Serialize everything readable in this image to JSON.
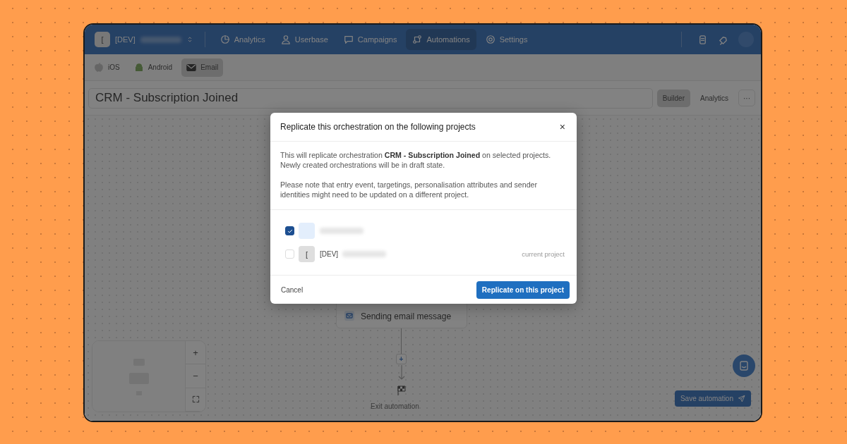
{
  "nav": {
    "project_initial": "[",
    "project_label": "[DEV]",
    "items": [
      {
        "label": "Analytics",
        "selected": false
      },
      {
        "label": "Userbase",
        "selected": false
      },
      {
        "label": "Campaigns",
        "selected": false
      },
      {
        "label": "Automations",
        "selected": true
      },
      {
        "label": "Settings",
        "selected": false
      }
    ]
  },
  "platform_tabs": [
    {
      "label": "iOS",
      "selected": false
    },
    {
      "label": "Android",
      "selected": false
    },
    {
      "label": "Email",
      "selected": true
    }
  ],
  "title": "CRM - Subscription Joined",
  "view_tabs": [
    {
      "label": "Builder",
      "selected": true
    },
    {
      "label": "Analytics",
      "selected": false
    }
  ],
  "more_button": "···",
  "canvas": {
    "node": "Sending email message",
    "exit": "Exit automation",
    "add": "+",
    "zoom_in": "+",
    "zoom_out": "−",
    "save_button": "Save automation"
  },
  "modal": {
    "title": "Replicate this orchestration on the following projects",
    "close": "×",
    "paragraphs": [
      "This will replicate orchestration **CRM - Subscription Joined** on selected projects. Newly created orchestrations will be in draft state.",
      "Please note that entry event, targetings, personalisation attributes and sender identities might need to be updated on a different project."
    ],
    "projects": [
      {
        "checked": true
      },
      {
        "initial": "[",
        "label": "[DEV]",
        "checked": false,
        "note": "current project"
      }
    ],
    "cancel": "Cancel",
    "confirm": "Replicate on this project"
  }
}
